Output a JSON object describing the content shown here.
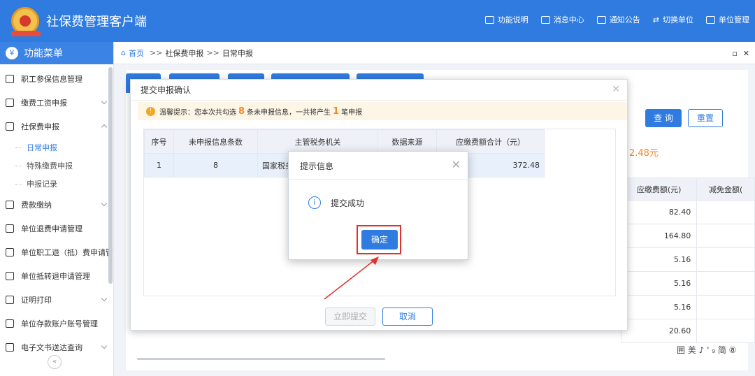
{
  "header": {
    "app_title": "社保费管理客户端",
    "nav": [
      "功能说明",
      "消息中心",
      "通知公告",
      "切换单位",
      "单位管理"
    ]
  },
  "sidebar": {
    "title": "功能菜单",
    "items": [
      {
        "label": "职工参保信息管理"
      },
      {
        "label": "缴费工资申报"
      },
      {
        "label": "社保费申报"
      },
      {
        "label": "费款缴纳"
      },
      {
        "label": "单位退费申请管理"
      },
      {
        "label": "单位职工退（抵）费申请管"
      },
      {
        "label": "单位抵转退申请管理"
      },
      {
        "label": "证明打印"
      },
      {
        "label": "单位存款账户账号管理"
      },
      {
        "label": "电子文书送达查询"
      }
    ],
    "sub_items": [
      "日常申报",
      "特殊缴费申报",
      "申报记录"
    ]
  },
  "breadcrumb": {
    "home": "首页",
    "sep": ">>",
    "path1": "社保费申报",
    "path2": "日常申报"
  },
  "background": {
    "query_label": "查 询",
    "reset_label": "重置",
    "total_amount": "2.48元",
    "col_due": "应缴费额(元)",
    "col_exempt": "减免金额(",
    "due_values": [
      "82.40",
      "164.80",
      "5.16",
      "5.16",
      "5.16",
      "20.60"
    ]
  },
  "confirm_dialog": {
    "title": "提交申报确认",
    "tip_prefix": "温馨提示：您本次共勾选",
    "tip_count": "8",
    "tip_mid": "条未申报信息，一共将产生",
    "tip_records": "1",
    "tip_suffix": "笔申报",
    "columns": [
      "序号",
      "未申报信息条数",
      "主管税务机关",
      "数据来源",
      "应缴费额合计（元）"
    ],
    "rows": [
      {
        "index": "1",
        "count": "8",
        "authority": "国家税务",
        "source": "",
        "total": "372.48"
      }
    ],
    "submit_label": "立即提交",
    "cancel_label": "取消"
  },
  "popup": {
    "title": "提示信息",
    "message": "提交成功",
    "ok_label": "确定"
  },
  "watermark": "囲 美 ♪ ' ₉ 简 ⑧"
}
